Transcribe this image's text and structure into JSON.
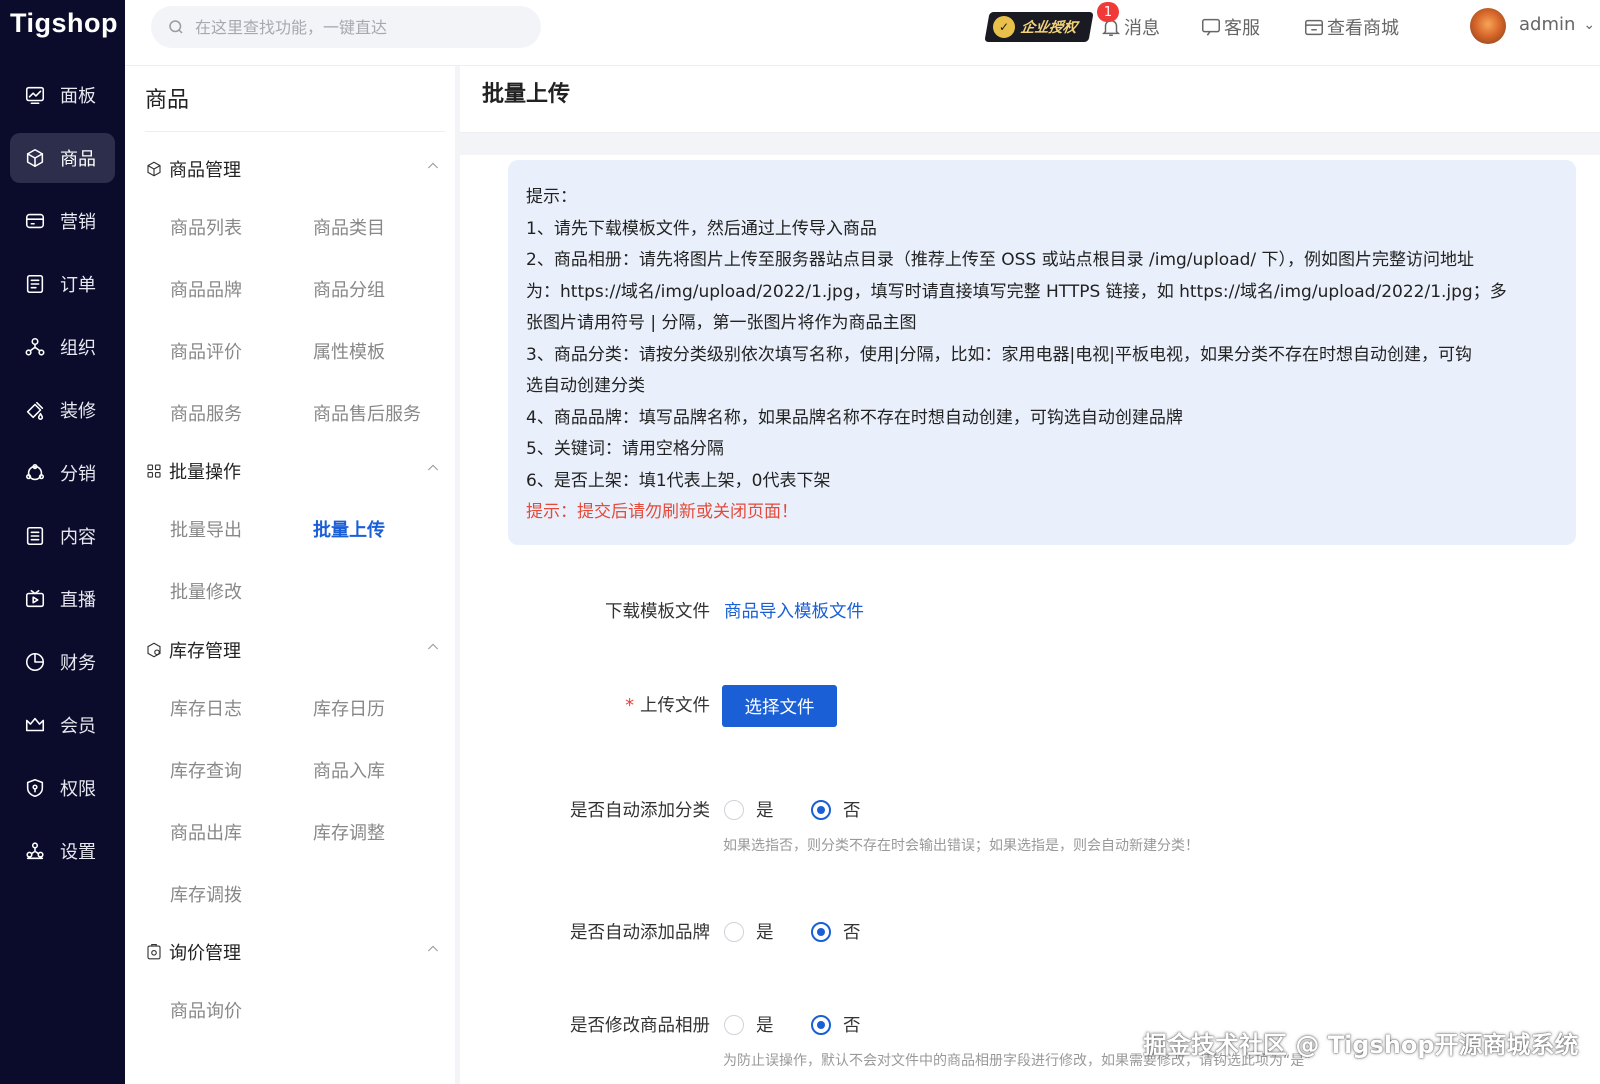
{
  "app": {
    "logo": "Tigshop"
  },
  "header": {
    "search_placeholder": "在这里查找功能，一键直达",
    "license_label": "企业授权",
    "messages_label": "消息",
    "messages_badge": "1",
    "service_label": "客服",
    "store_label": "查看商城",
    "username": "admin"
  },
  "sidebar": {
    "items": [
      {
        "label": "面板",
        "icon": "dashboard-icon"
      },
      {
        "label": "商品",
        "icon": "box-icon"
      },
      {
        "label": "营销",
        "icon": "marketing-icon"
      },
      {
        "label": "订单",
        "icon": "order-icon"
      },
      {
        "label": "组织",
        "icon": "organization-icon"
      },
      {
        "label": "装修",
        "icon": "decorate-icon"
      },
      {
        "label": "分销",
        "icon": "distribution-icon"
      },
      {
        "label": "内容",
        "icon": "content-icon"
      },
      {
        "label": "直播",
        "icon": "live-icon"
      },
      {
        "label": "财务",
        "icon": "finance-icon"
      },
      {
        "label": "会员",
        "icon": "member-icon"
      },
      {
        "label": "权限",
        "icon": "permission-icon"
      },
      {
        "label": "设置",
        "icon": "settings-icon"
      }
    ],
    "active": "商品"
  },
  "subnav": {
    "title": "商品",
    "groups": [
      {
        "label": "商品管理",
        "items": [
          "商品列表",
          "商品类目",
          "商品品牌",
          "商品分组",
          "商品评价",
          "属性模板",
          "商品服务",
          "商品售后服务"
        ]
      },
      {
        "label": "批量操作",
        "items": [
          "批量导出",
          "批量上传",
          "批量修改"
        ]
      },
      {
        "label": "库存管理",
        "items": [
          "库存日志",
          "库存日历",
          "库存查询",
          "商品入库",
          "商品出库",
          "库存调整",
          "库存调拨"
        ]
      },
      {
        "label": "询价管理",
        "items": [
          "商品询价"
        ]
      }
    ],
    "active_item": "批量上传"
  },
  "main": {
    "title": "批量上传",
    "tips": [
      "提示：",
      "1、请先下载模板文件，然后通过上传导入商品",
      "2、商品相册：请先将图片上传至服务器站点目录（推荐上传至 OSS 或站点根目录 /img/upload/ 下），例如图片完整访问地址",
      "为：https://域名/img/upload/2022/1.jpg，填写时请直接填写完整 HTTPS 链接，如 https://域名/img/upload/2022/1.jpg；多",
      "张图片请用符号 | 分隔，第一张图片将作为商品主图",
      "3、商品分类：请按分类级别依次填写名称，使用|分隔，比如：家用电器|电视|平板电视，如果分类不存在时想自动创建，可钩",
      "选自动创建分类",
      "4、商品品牌：填写品牌名称，如果品牌名称不存在时想自动创建，可钩选自动创建品牌",
      "5、关键词：请用空格分隔",
      "6、是否上架：填1代表上架，0代表下架"
    ],
    "tips_warning": "提示：提交后请勿刷新或关闭页面！",
    "download_label": "下载模板文件",
    "download_link": "商品导入模板文件",
    "upload_label": "上传文件",
    "upload_button": "选择文件",
    "auto_category_label": "是否自动添加分类",
    "auto_category_hint": "如果选指否，则分类不存在时会输出错误；如果选指是，则会自动新建分类！",
    "auto_brand_label": "是否自动添加品牌",
    "modify_gallery_label": "是否修改商品相册",
    "modify_gallery_hint": "为防止误操作，默认不会对文件中的商品相册字段进行修改，如果需要修改，请钩选此项为“是”",
    "yes": "是",
    "no": "否",
    "selected": "否"
  },
  "watermark": "掘金技术社区 @ Tigshop开源商城系统",
  "colors": {
    "sidebar_bg": "#0b0c2b",
    "accent": "#1a5fd6",
    "tips_bg": "#eaf0fb",
    "warning": "#e34a3a"
  }
}
